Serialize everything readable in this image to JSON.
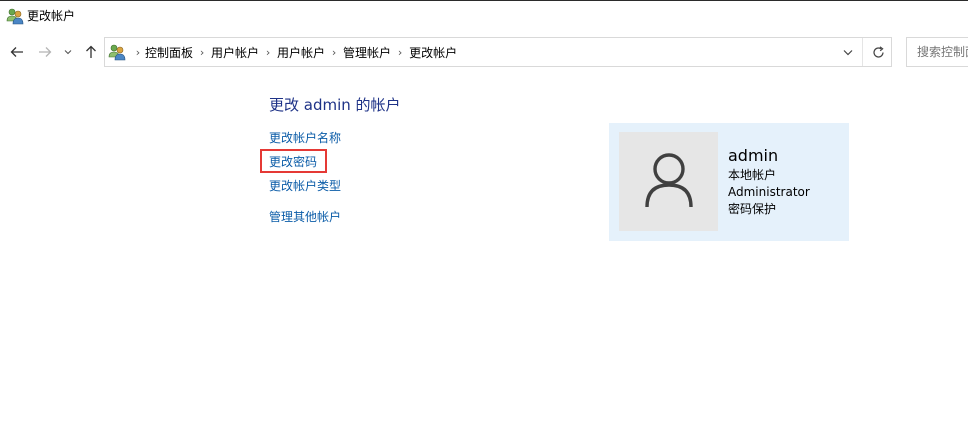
{
  "window": {
    "title": "更改帐户",
    "icon": "user-accounts-icon"
  },
  "nav": {
    "back_icon": "arrow-left-icon",
    "forward_icon": "arrow-right-icon",
    "recent_icon": "chevron-down-icon",
    "up_icon": "arrow-up-icon"
  },
  "address": {
    "breadcrumbs": [
      "控制面板",
      "用户帐户",
      "用户帐户",
      "管理帐户",
      "更改帐户"
    ],
    "separator": "›"
  },
  "search": {
    "placeholder": "搜索控制面板"
  },
  "main": {
    "heading": "更改 admin 的帐户",
    "links": {
      "rename": "更改帐户名称",
      "password": "更改密码",
      "type": "更改帐户类型",
      "manage": "管理其他帐户"
    }
  },
  "account": {
    "name": "admin",
    "type": "本地帐户",
    "role": "Administrator",
    "password_status": "密码保护"
  },
  "colors": {
    "link": "#0b5ca8",
    "heading": "#1e3287",
    "card_bg": "#e5f1fb",
    "highlight": "#e53935"
  }
}
